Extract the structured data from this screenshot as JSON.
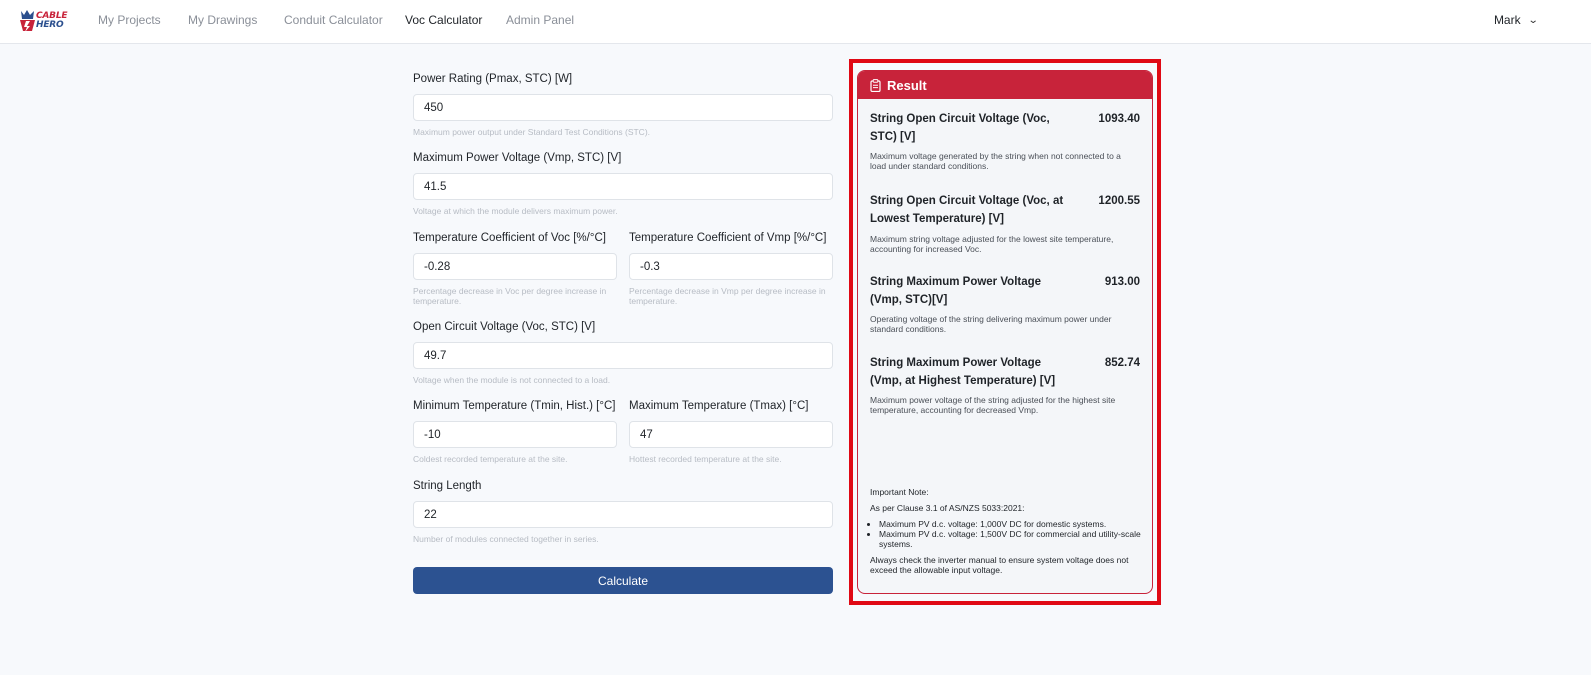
{
  "logo": {
    "line1": "CABLE",
    "line2": "HERO"
  },
  "nav": {
    "items": [
      {
        "label": "My Projects"
      },
      {
        "label": "My Drawings"
      },
      {
        "label": "Conduit Calculator"
      },
      {
        "label": "Voc Calculator",
        "active": true
      },
      {
        "label": "Admin Panel"
      }
    ],
    "user": "Mark"
  },
  "form": {
    "power_rating": {
      "label": "Power Rating (Pmax, STC) [W]",
      "value": "450",
      "help": "Maximum power output under Standard Test Conditions (STC)."
    },
    "vmp": {
      "label": "Maximum Power Voltage (Vmp, STC) [V]",
      "value": "41.5",
      "help": "Voltage at which the module delivers maximum power."
    },
    "temp_coef_voc": {
      "label": "Temperature Coefficient of Voc [%/°C]",
      "value": "-0.28",
      "help": "Percentage decrease in Voc per degree increase in temperature."
    },
    "temp_coef_vmp": {
      "label": "Temperature Coefficient of Vmp [%/°C]",
      "value": "-0.3",
      "help": "Percentage decrease in Vmp per degree increase in temperature."
    },
    "voc": {
      "label": "Open Circuit Voltage (Voc, STC) [V]",
      "value": "49.7",
      "help": "Voltage when the module is not connected to a load."
    },
    "tmin": {
      "label": "Minimum Temperature (Tmin, Hist.) [°C]",
      "value": "-10",
      "help": "Coldest recorded temperature at the site."
    },
    "tmax": {
      "label": "Maximum Temperature (Tmax) [°C]",
      "value": "47",
      "help": "Hottest recorded temperature at the site."
    },
    "string_length": {
      "label": "String Length",
      "value": "22",
      "help": "Number of modules connected together in series."
    },
    "calculate_label": "Calculate"
  },
  "result": {
    "header": "Result",
    "items": [
      {
        "title": "String Open Circuit Voltage (Voc, STC) [V]",
        "value": "1093.40",
        "desc": "Maximum voltage generated by the string when not connected to a load under standard conditions."
      },
      {
        "title": "String Open Circuit Voltage (Voc, at Lowest Temperature) [V]",
        "value": "1200.55",
        "desc": "Maximum string voltage adjusted for the lowest site temperature, accounting for increased Voc."
      },
      {
        "title": "String Maximum Power Voltage (Vmp, STC)[V]",
        "value": "913.00",
        "desc": "Operating voltage of the string delivering maximum power under standard conditions."
      },
      {
        "title": "String Maximum Power Voltage (Vmp, at Highest Temperature) [V]",
        "value": "852.74",
        "desc": "Maximum power voltage of the string adjusted for the highest site temperature, accounting for decreased Vmp."
      }
    ],
    "note": {
      "heading": "Important Note:",
      "clause": "As per Clause 3.1 of AS/NZS 5033:2021:",
      "bullets": [
        "Maximum PV d.c. voltage: 1,000V DC for domestic systems.",
        "Maximum PV d.c. voltage: 1,500V DC for commercial and utility-scale systems."
      ],
      "footer": "Always check the inverter manual to ensure system voltage does not exceed the allowable input voltage."
    }
  },
  "colors": {
    "brand_red": "#c8233a",
    "brand_blue": "#2c5291",
    "highlight": "#e00914"
  }
}
